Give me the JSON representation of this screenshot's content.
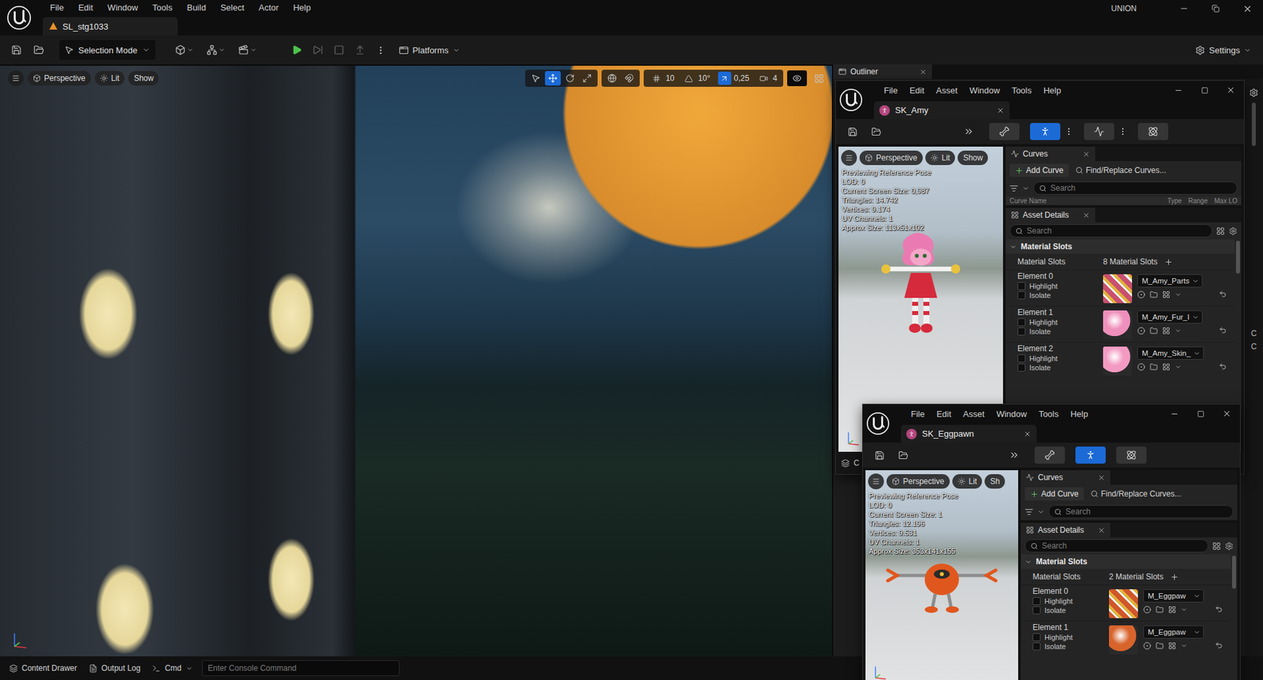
{
  "editor": {
    "menu": [
      "File",
      "Edit",
      "Window",
      "Tools",
      "Build",
      "Select",
      "Actor",
      "Help"
    ],
    "level_tab": "SL_stg1033",
    "project": "UNION"
  },
  "toolbar": {
    "mode": "Selection Mode",
    "controls": [
      {
        "kind": "play",
        "disabled": false
      },
      {
        "kind": "advance",
        "disabled": true
      },
      {
        "kind": "stop",
        "disabled": true
      },
      {
        "kind": "eject",
        "disabled": true
      }
    ],
    "platforms": "Platforms",
    "settings": "Settings"
  },
  "viewport": {
    "buttons": [
      {
        "label": "Perspective",
        "kind": "view"
      },
      {
        "label": "Lit",
        "kind": "lit"
      },
      {
        "label": "Show",
        "kind": "plain"
      }
    ],
    "tools": [
      {
        "kind": "select",
        "selected": false
      },
      {
        "kind": "move",
        "selected": true
      },
      {
        "kind": "rotate",
        "selected": false
      },
      {
        "kind": "scale",
        "selected": false
      }
    ],
    "snaps": [
      {
        "kind": "grid",
        "value": "10",
        "active": false
      },
      {
        "kind": "angle",
        "value": "10°",
        "active": false
      },
      {
        "kind": "scale",
        "value": "0,25",
        "active": true
      },
      {
        "kind": "camera",
        "value": "4",
        "active": false
      }
    ]
  },
  "outliner": {
    "title": "Outliner"
  },
  "dock": {
    "peek_labels": [
      "C",
      "C"
    ]
  },
  "asset_windows": [
    {
      "menu": [
        "File",
        "Edit",
        "Asset",
        "Window",
        "Tools",
        "Help"
      ],
      "tab": "SK_Amy",
      "modes": [
        {
          "kind": "skeleton",
          "selected": false,
          "more": false
        },
        {
          "kind": "mesh",
          "selected": true,
          "more": true
        },
        {
          "kind": "animation",
          "selected": false,
          "more": true
        },
        {
          "kind": "physics",
          "selected": false,
          "more": false
        }
      ],
      "preview": {
        "buttons": [
          {
            "label": "Perspective",
            "kind": "view"
          },
          {
            "label": "Lit",
            "kind": "lit"
          },
          {
            "label": "Show",
            "kind": "plain"
          }
        ],
        "stats": [
          "Previewing Reference Pose",
          "LOD: 0",
          "Current Screen Size: 0,987",
          "Triangles: 14.742",
          "Vertices: 9.174",
          "UV Channels: 1",
          "Approx Size: 113x51x102"
        ],
        "figure_kind": "amy"
      },
      "curves": {
        "title": "Curves",
        "add": "Add Curve",
        "find": "Find/Replace Curves...",
        "search": "Search",
        "columns": [
          "Curve Name",
          "Type",
          "Range",
          "Max LO"
        ]
      },
      "details": {
        "title": "Asset Details",
        "search": "Search",
        "section": "Material Slots",
        "slots_label": "Material Slots",
        "slots_count": "8 Material Slots",
        "elements": [
          {
            "name": "Element 0",
            "material": "M_Amy_Parts",
            "thumb_kind": "texture",
            "color": "#c9506e",
            "options": [
              {
                "label": "Highlight",
                "checked": false
              },
              {
                "label": "Isolate",
                "checked": false
              }
            ]
          },
          {
            "name": "Element 1",
            "material": "M_Amy_Fur_I",
            "thumb_kind": "sphere",
            "color": "#ef8fbc",
            "options": [
              {
                "label": "Highlight",
                "checked": false
              },
              {
                "label": "Isolate",
                "checked": false
              }
            ]
          },
          {
            "name": "Element 2",
            "material": "M_Amy_Skin_",
            "thumb_kind": "sphere",
            "color": "#f29ac2",
            "options": [
              {
                "label": "Highlight",
                "checked": false
              },
              {
                "label": "Isolate",
                "checked": false
              }
            ]
          }
        ]
      },
      "footer": "C"
    },
    {
      "menu": [
        "File",
        "Edit",
        "Asset",
        "Window",
        "Tools",
        "Help"
      ],
      "tab": "SK_Eggpawn",
      "modes": [
        {
          "kind": "skeleton",
          "selected": false,
          "more": false
        },
        {
          "kind": "mesh",
          "selected": true,
          "more": false
        },
        {
          "kind": "physics",
          "selected": false,
          "more": false
        }
      ],
      "preview": {
        "buttons": [
          {
            "label": "Perspective",
            "kind": "view"
          },
          {
            "label": "Lit",
            "kind": "lit"
          },
          {
            "label": "Sh",
            "kind": "plain"
          }
        ],
        "stats": [
          "Previewing Reference Pose",
          "LOD: 0",
          "Current Screen Size: 1",
          "Triangles: 12.196",
          "Vertices: 9.531",
          "UV Channels: 1",
          "Approx Size: 353x141x155"
        ],
        "figure_kind": "eggpawn"
      },
      "curves": {
        "title": "Curves",
        "add": "Add Curve",
        "find": "Find/Replace Curves...",
        "search": "Search",
        "columns": []
      },
      "details": {
        "title": "Asset Details",
        "search": "Search",
        "section": "Material Slots",
        "slots_label": "Material Slots",
        "slots_count": "2 Material Slots",
        "elements": [
          {
            "name": "Element 0",
            "material": "M_Eggpaw",
            "thumb_kind": "texture",
            "color": "#d0572a",
            "options": [
              {
                "label": "Highlight",
                "checked": false
              },
              {
                "label": "Isolate",
                "checked": false
              }
            ]
          },
          {
            "name": "Element 1",
            "material": "M_Eggpaw",
            "thumb_kind": "sphere",
            "color": "#d8642c",
            "options": [
              {
                "label": "Highlight",
                "checked": false
              },
              {
                "label": "Isolate",
                "checked": false
              }
            ]
          }
        ]
      },
      "footer": ""
    }
  ],
  "status_bar": {
    "items": [
      {
        "label": "Content Drawer",
        "kind": "drawer"
      },
      {
        "label": "Output Log",
        "kind": "log"
      },
      {
        "label": "Cmd",
        "kind": "cmd"
      }
    ],
    "console_placeholder": "Enter Console Command"
  }
}
